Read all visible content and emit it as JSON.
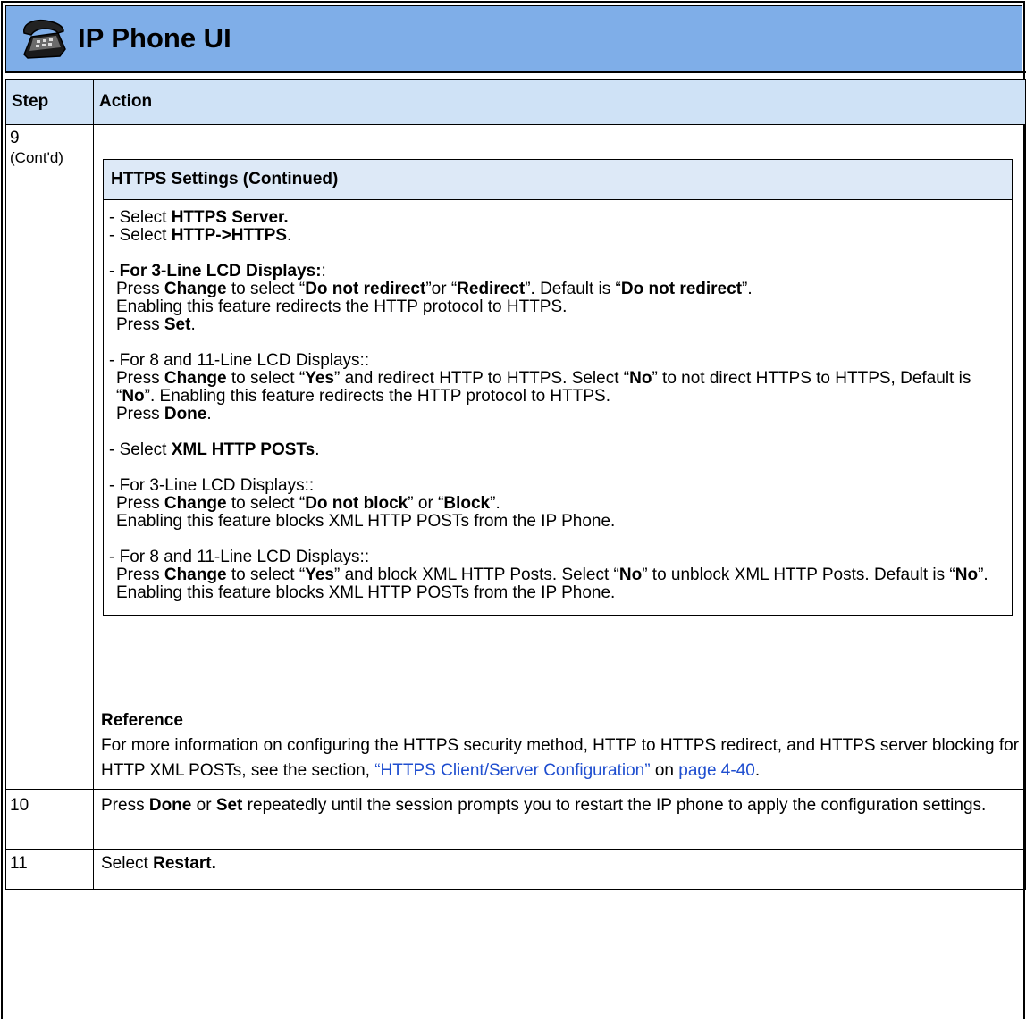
{
  "header": {
    "title": "IP Phone UI",
    "icon": "phone-icon",
    "color": "#7faee8"
  },
  "table": {
    "col_step": "Step",
    "col_action": "Action",
    "rows": [
      {
        "step": "9",
        "step_note": "(Cont'd)",
        "box_title": "HTTPS Settings (Continued)",
        "l1_a": "- Select ",
        "l1_b": "HTTPS Server.",
        "l2_a": "- Select ",
        "l2_b": "HTTP->HTTPS",
        "l2_c": ".",
        "l3_a": "- ",
        "l3_b": "For 3-Line LCD Displays:",
        "l3_c": ":",
        "l4_a": "Press ",
        "l4_b": "Change",
        "l4_c": " to select “",
        "l4_d": "Do not redirect",
        "l4_e": "”or “",
        "l4_f": "Redirect",
        "l4_g": "”. Default is “",
        "l4_h": "Do not redirect",
        "l4_i": "”.",
        "l5": "Enabling this feature redirects the HTTP protocol to HTTPS.",
        "l6_a": "Press ",
        "l6_b": "Set",
        "l6_c": ".",
        "l7": "- For 8 and 11-Line LCD Displays::",
        "l8_a": "Press ",
        "l8_b": "Change",
        "l8_c": " to select “",
        "l8_d": "Yes",
        "l8_e": "” and redirect HTTP to HTTPS. Select “",
        "l8_f": "No",
        "l8_g": "” to not direct HTTPS to HTTPS, Default is “",
        "l8_h": "No",
        "l8_i": "”. Enabling this feature redirects the HTTP protocol to HTTPS.",
        "l9_a": "Press ",
        "l9_b": "Done",
        "l9_c": ".",
        "l10_a": "- Select ",
        "l10_b": "XML HTTP POSTs",
        "l10_c": ".",
        "l11": "- For 3-Line LCD Displays::",
        "l12_a": "Press ",
        "l12_b": "Change",
        "l12_c": " to select “",
        "l12_d": "Do not block",
        "l12_e": "” or “",
        "l12_f": "Block",
        "l12_g": "”.",
        "l13": "Enabling this feature blocks XML HTTP POSTs from the IP Phone.",
        "l14": "- For 8 and 11-Line LCD Displays::",
        "l15_a": "Press ",
        "l15_b": "Change",
        "l15_c": " to select “",
        "l15_d": "Yes",
        "l15_e": "” and block XML HTTP Posts. Select “",
        "l15_f": "No",
        "l15_g": "” to unblock XML HTTP Posts. Default is “",
        "l15_h": "No",
        "l15_i": "”. Enabling this feature blocks XML HTTP POSTs from the IP Phone.",
        "ref_title": "Reference",
        "ref_a": "For more information on configuring the HTTPS security method, HTTP to HTTPS redirect, and HTTPS server blocking for HTTP XML POSTs, see the section, ",
        "ref_link1": "“HTTPS Client/Server Configuration”",
        "ref_b": " on ",
        "ref_link2": "page 4-40",
        "ref_c": "."
      },
      {
        "step": "10",
        "a": "Press ",
        "b": "Done",
        "c": " or ",
        "d": "Set",
        "e": " repeatedly until the session prompts you to restart the IP phone to apply the configuration settings."
      },
      {
        "step": "11",
        "a": "Select ",
        "b": "Restart."
      }
    ]
  },
  "colors": {
    "banner": "#7faee8",
    "table_header": "#cfe2f6",
    "box_header": "#dde9f7",
    "link": "#1f4ecf"
  }
}
